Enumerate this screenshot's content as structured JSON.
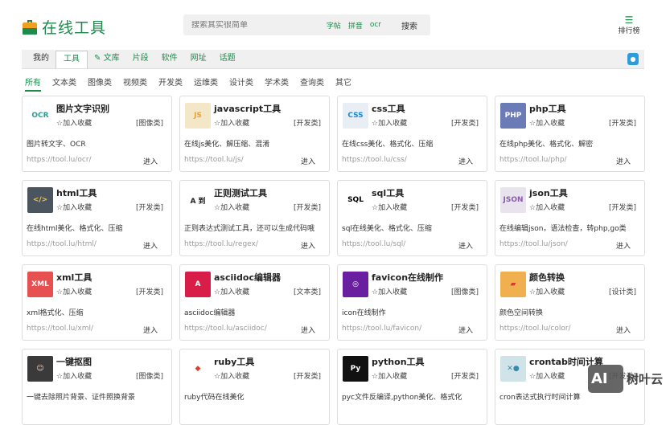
{
  "header": {
    "title": "在线工具",
    "search_placeholder": "搜索其实很简单",
    "quick_links": [
      "字帖",
      "拼音",
      "ocr"
    ],
    "search_button": "搜索",
    "rank_label": "排行榜"
  },
  "nav": {
    "tabs": [
      "我的",
      "工具",
      "文库",
      "片段",
      "软件",
      "网址",
      "话题"
    ],
    "active": "工具"
  },
  "categories": [
    "所有",
    "文本类",
    "图像类",
    "视频类",
    "开发类",
    "运维类",
    "设计类",
    "学术类",
    "查询类",
    "其它"
  ],
  "fav_label": "☆加入收藏",
  "enter_label": "进入",
  "tools": [
    {
      "name": "图片文字识别",
      "cat": "[图像类]",
      "desc": "图片转文字、OCR",
      "url": "https://tool.lu/ocr/",
      "icon": "OCR",
      "bg": "#fff",
      "fg": "#2a9d8f"
    },
    {
      "name": "javascript工具",
      "cat": "[开发类]",
      "desc": "在线js美化、解压缩、混淆",
      "url": "https://tool.lu/js/",
      "icon": "JS",
      "bg": "#f3e7c8",
      "fg": "#e8a23a"
    },
    {
      "name": "css工具",
      "cat": "[开发类]",
      "desc": "在线css美化、格式化、压缩",
      "url": "https://tool.lu/css/",
      "icon": "CSS",
      "bg": "#e8eef3",
      "fg": "#1e88d0"
    },
    {
      "name": "php工具",
      "cat": "[开发类]",
      "desc": "在线php美化、格式化、解密",
      "url": "https://tool.lu/php/",
      "icon": "PHP",
      "bg": "#6b7bb5",
      "fg": "#fff"
    },
    {
      "name": "html工具",
      "cat": "[开发类]",
      "desc": "在线html美化、格式化、压缩",
      "url": "https://tool.lu/html/",
      "icon": "</>",
      "bg": "#4a5560",
      "fg": "#f3c650"
    },
    {
      "name": "正则测试工具",
      "cat": "[开发类]",
      "desc": "正则表达式测试工具，还可以生成代码哦",
      "url": "https://tool.lu/regex/",
      "icon": "A 到",
      "bg": "#fff",
      "fg": "#222"
    },
    {
      "name": "sql工具",
      "cat": "[开发类]",
      "desc": "sql在线美化、格式化、压缩",
      "url": "https://tool.lu/sql/",
      "icon": "SQL",
      "bg": "#fff",
      "fg": "#000"
    },
    {
      "name": "json工具",
      "cat": "[开发类]",
      "desc": "在线编辑json，语法检查，转php,go类",
      "url": "https://tool.lu/json/",
      "icon": "JSON",
      "bg": "#e9e3ee",
      "fg": "#8a5ca8"
    },
    {
      "name": "xml工具",
      "cat": "[开发类]",
      "desc": "xml格式化、压缩",
      "url": "https://tool.lu/xml/",
      "icon": "XML",
      "bg": "#e65050",
      "fg": "#fff"
    },
    {
      "name": "asciidoc编辑器",
      "cat": "[文本类]",
      "desc": "asciidoc编辑器",
      "url": "https://tool.lu/asciidoc/",
      "icon": "A",
      "bg": "#d81e48",
      "fg": "#fff"
    },
    {
      "name": "favicon在线制作",
      "cat": "[图像类]",
      "desc": "icon在线制作",
      "url": "https://tool.lu/favicon/",
      "icon": "◎",
      "bg": "#6a1fa0",
      "fg": "#fff"
    },
    {
      "name": "颜色转换",
      "cat": "[设计类]",
      "desc": "颜色空间转换",
      "url": "https://tool.lu/color/",
      "icon": "▰",
      "bg": "#f0b050",
      "fg": "#d83a2a"
    },
    {
      "name": "一键抠图",
      "cat": "[图像类]",
      "desc": "一键去除照片背景、证件照换背景",
      "url": "",
      "icon": "☺",
      "bg": "#3a3a3a",
      "fg": "#f0d0c0"
    },
    {
      "name": "ruby工具",
      "cat": "[开发类]",
      "desc": "ruby代码在线美化",
      "url": "",
      "icon": "◆",
      "bg": "#fff",
      "fg": "#e03a2a"
    },
    {
      "name": "python工具",
      "cat": "[开发类]",
      "desc": "pyc文件反编译,python美化、格式化",
      "url": "",
      "icon": "Py",
      "bg": "#111",
      "fg": "#fff"
    },
    {
      "name": "crontab时间计算",
      "cat": "[开发类]",
      "desc": "cron表达式执行时间计算",
      "url": "",
      "icon": "✕●",
      "bg": "#cfe3e8",
      "fg": "#3a8ab0"
    }
  ],
  "watermark": {
    "text": "树叶云",
    "mark": "AI"
  }
}
